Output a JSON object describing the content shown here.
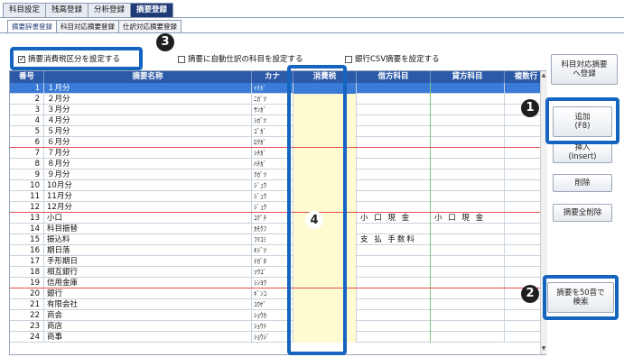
{
  "top_tabs": [
    "科目設定",
    "残高登録",
    "分析登録",
    "摘要登録"
  ],
  "sub_tabs": [
    "摘要辞書登録",
    "科目対応摘要登録",
    "仕訳対応摘要登録"
  ],
  "options": {
    "tax_category": "摘要消費税区分を設定する",
    "auto_journal": "摘要に自動仕訳の科目を設定する",
    "bank_csv": "銀行CSV摘要を設定する"
  },
  "table": {
    "headers": {
      "no": "番号",
      "name": "摘要名称",
      "kana": "カナ",
      "tax": "消費税",
      "debit": "借方科目",
      "credit": "貸方科目",
      "multi": "複数行"
    },
    "rows": [
      {
        "no": "1",
        "name": "１月分",
        "kana": "ｲﾁｶﾞ",
        "debit": "",
        "credit": ""
      },
      {
        "no": "2",
        "name": "２月分",
        "kana": "ﾆｶﾞﾂ",
        "debit": "",
        "credit": ""
      },
      {
        "no": "3",
        "name": "３月分",
        "kana": "ｻﾝｶﾞ",
        "debit": "",
        "credit": ""
      },
      {
        "no": "4",
        "name": "４月分",
        "kana": "ｼｶﾞﾂ",
        "debit": "",
        "credit": ""
      },
      {
        "no": "5",
        "name": "５月分",
        "kana": "ｺﾞｶﾞ",
        "debit": "",
        "credit": ""
      },
      {
        "no": "6",
        "name": "６月分",
        "kana": "ﾛｸｶﾞ",
        "debit": "",
        "credit": ""
      },
      {
        "no": "7",
        "name": "７月分",
        "kana": "ｼﾁｶﾞ",
        "debit": "",
        "credit": ""
      },
      {
        "no": "8",
        "name": "８月分",
        "kana": "ﾊﾁｶﾞ",
        "debit": "",
        "credit": ""
      },
      {
        "no": "9",
        "name": "９月分",
        "kana": "ｸｶﾞﾂ",
        "debit": "",
        "credit": ""
      },
      {
        "no": "10",
        "name": "10月分",
        "kana": "ｼﾞｭｳ",
        "debit": "",
        "credit": ""
      },
      {
        "no": "11",
        "name": "11月分",
        "kana": "ｼﾞｭｳ",
        "debit": "",
        "credit": ""
      },
      {
        "no": "12",
        "name": "12月分",
        "kana": "ｼﾞｭｳ",
        "debit": "",
        "credit": ""
      },
      {
        "no": "13",
        "name": "小口",
        "kana": "ｺｸﾞﾁ",
        "debit": "小 口 現 金",
        "credit": "小 口 現 金"
      },
      {
        "no": "14",
        "name": "科目振替",
        "kana": "ｶﾓｸﾌ",
        "debit": "",
        "credit": ""
      },
      {
        "no": "15",
        "name": "振込料",
        "kana": "ﾌﾘｺﾐ",
        "debit": "支 払 手数料",
        "credit": ""
      },
      {
        "no": "16",
        "name": "期日落",
        "kana": "ｷｼﾞﾂ",
        "debit": "",
        "credit": ""
      },
      {
        "no": "17",
        "name": "手形期日",
        "kana": "ﾃｶﾞﾀ",
        "debit": "",
        "credit": ""
      },
      {
        "no": "18",
        "name": "相互銀行",
        "kana": "ｿｳｺﾞ",
        "debit": "",
        "credit": ""
      },
      {
        "no": "19",
        "name": "信用金庫",
        "kana": "ｼﾝﾖｳ",
        "debit": "",
        "credit": ""
      },
      {
        "no": "20",
        "name": "銀行",
        "kana": "ｷﾞﾝｺ",
        "debit": "",
        "credit": ""
      },
      {
        "no": "21",
        "name": "有限会社",
        "kana": "ﾕｳｹﾞ",
        "debit": "",
        "credit": ""
      },
      {
        "no": "22",
        "name": "商会",
        "kana": "ｼｮｳｶ",
        "debit": "",
        "credit": ""
      },
      {
        "no": "23",
        "name": "商店",
        "kana": "ｼｮｳﾃ",
        "debit": "",
        "credit": ""
      },
      {
        "no": "24",
        "name": "商事",
        "kana": "ｼｮｳｼﾞ",
        "debit": "",
        "credit": ""
      }
    ]
  },
  "buttons": {
    "register_line1": "科目対応摘要",
    "register_line2": "へ登録",
    "add_line1": "追加",
    "add_line2": "(F8)",
    "insert_line1": "挿入",
    "insert_line2": "(Insert)",
    "delete": "削除",
    "delete_all": "摘要全削除",
    "search_line1": "摘要を50音で",
    "search_line2": "検索"
  },
  "badges": {
    "b1": "1",
    "b2": "2",
    "b3": "3",
    "b4": "4"
  },
  "colors": {
    "highlight": "#1565c0",
    "header": "#2d5aa8",
    "selected_row": "#3a7bd8",
    "tax_column": "#fffbd0"
  }
}
